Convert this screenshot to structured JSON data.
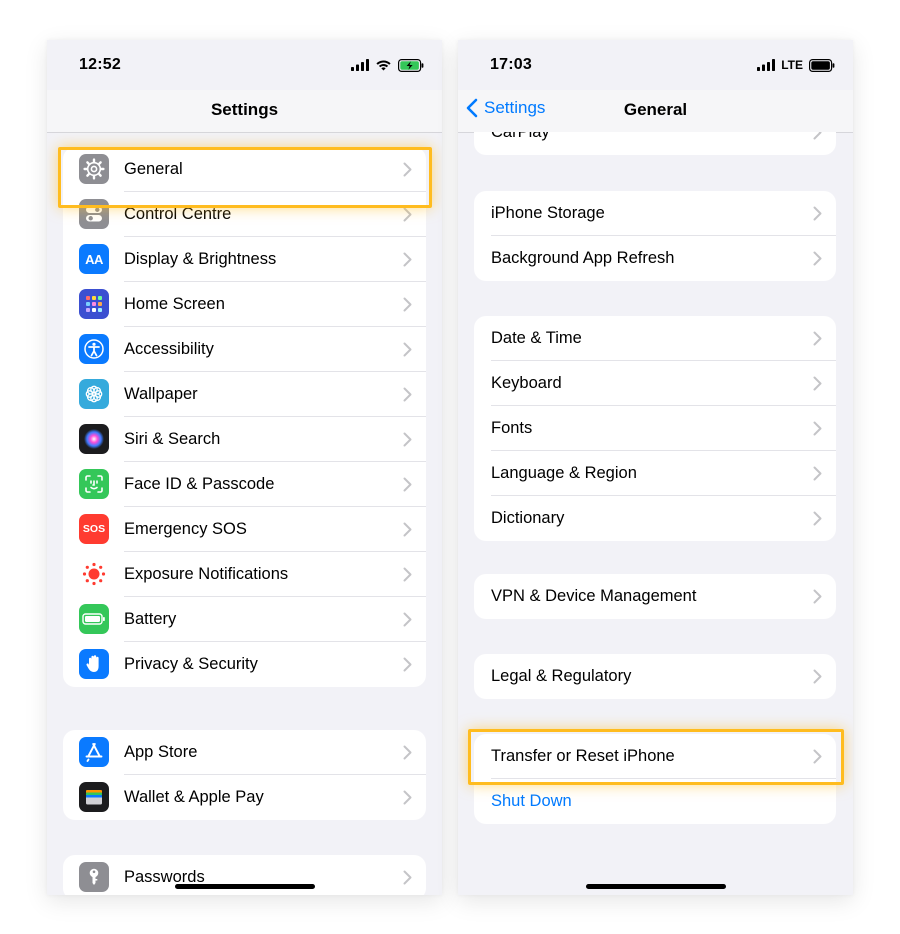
{
  "left_phone": {
    "status": {
      "time": "12:52"
    },
    "nav": {
      "title": "Settings"
    },
    "group1": [
      {
        "label": "General",
        "icon": "gear-icon",
        "color": "#8e8e93"
      },
      {
        "label": "Control Centre",
        "icon": "toggles-icon",
        "color": "#8e8e93"
      },
      {
        "label": "Display & Brightness",
        "icon": "text-size-icon",
        "color": "#0a7aff",
        "icon_text": "AA"
      },
      {
        "label": "Home Screen",
        "icon": "app-grid-icon",
        "color": "#3b4fd1"
      },
      {
        "label": "Accessibility",
        "icon": "accessibility-icon",
        "color": "#0a7aff"
      },
      {
        "label": "Wallpaper",
        "icon": "flower-icon",
        "color": "#35aadc"
      },
      {
        "label": "Siri & Search",
        "icon": "siri-icon",
        "color": "#1c1c1e"
      },
      {
        "label": "Face ID & Passcode",
        "icon": "face-id-icon",
        "color": "#34c759"
      },
      {
        "label": "Emergency SOS",
        "icon": "sos-icon",
        "color": "#ff3b30",
        "icon_text": "SOS"
      },
      {
        "label": "Exposure Notifications",
        "icon": "exposure-icon",
        "color": "#ffffff"
      },
      {
        "label": "Battery",
        "icon": "battery-icon",
        "color": "#34c759"
      },
      {
        "label": "Privacy & Security",
        "icon": "hand-icon",
        "color": "#0a7aff"
      }
    ],
    "group2": [
      {
        "label": "App Store",
        "icon": "app-store-icon",
        "color": "#0a7aff"
      },
      {
        "label": "Wallet & Apple Pay",
        "icon": "wallet-icon",
        "color": "#1c1c1e"
      }
    ],
    "group3": [
      {
        "label": "Passwords",
        "icon": "key-icon",
        "color": "#8e8e93"
      }
    ]
  },
  "right_phone": {
    "status": {
      "time": "17:03",
      "network": "LTE"
    },
    "nav": {
      "back_label": "Settings",
      "title": "General"
    },
    "group0": [
      {
        "label": "CarPlay"
      }
    ],
    "group1": [
      {
        "label": "iPhone Storage"
      },
      {
        "label": "Background App Refresh"
      }
    ],
    "group2": [
      {
        "label": "Date & Time"
      },
      {
        "label": "Keyboard"
      },
      {
        "label": "Fonts"
      },
      {
        "label": "Language & Region"
      },
      {
        "label": "Dictionary"
      }
    ],
    "group3": [
      {
        "label": "VPN & Device Management"
      }
    ],
    "group4": [
      {
        "label": "Legal & Regulatory"
      }
    ],
    "group5": [
      {
        "label": "Transfer or Reset iPhone"
      },
      {
        "label": "Shut Down"
      }
    ]
  },
  "colors": {
    "highlight": "#ffbc1f",
    "accent": "#007aff",
    "background": "#f2f2f7"
  }
}
